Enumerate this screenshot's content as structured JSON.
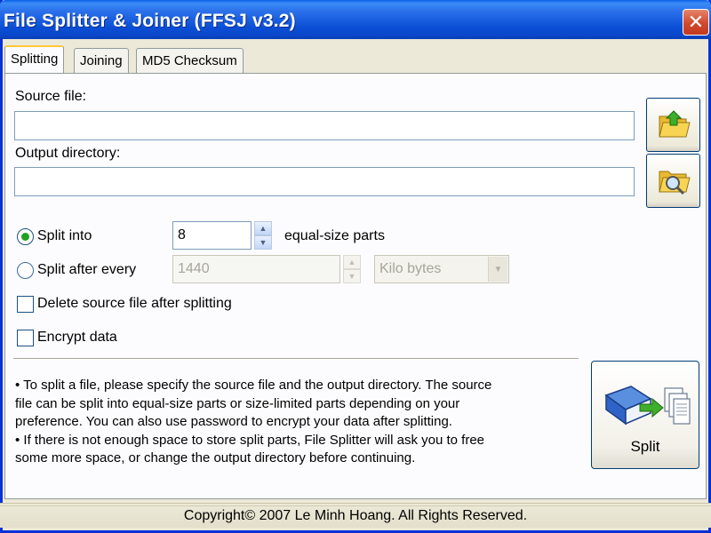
{
  "window": {
    "title": "File Splitter & Joiner (FFSJ v3.2)",
    "close_glyph": "✕"
  },
  "tabs": [
    {
      "label": "Splitting",
      "active": true
    },
    {
      "label": "Joining",
      "active": false
    },
    {
      "label": "MD5 Checksum",
      "active": false
    }
  ],
  "splitting": {
    "source_label": "Source file:",
    "source_value": "",
    "output_label": "Output directory:",
    "output_value": "",
    "browse_source_icon": "folder-open-icon",
    "browse_output_icon": "folder-search-icon",
    "split_into": {
      "label": "Split into",
      "value": "8",
      "suffix": "equal-size parts",
      "selected": true
    },
    "split_after": {
      "label": "Split after every",
      "value": "1440",
      "unit": "Kilo bytes",
      "selected": false
    },
    "delete_source": {
      "label": "Delete source file after splitting",
      "checked": false
    },
    "encrypt": {
      "label": "Encrypt data",
      "checked": false
    },
    "info_lines": [
      "• To split a file, please specify the source file and the output directory. The source",
      "file can be split into equal-size parts or size-limited parts depending on your",
      "preference. You can also use password to encrypt your data after splitting.",
      "• If there is not enough space to store split parts, File Splitter will ask you to free",
      "some more space, or change the output directory before continuing."
    ],
    "split_button": {
      "label": "Split",
      "icon": "book-split-icon"
    }
  },
  "status": {
    "text": "Copyright© 2007 Le Minh Hoang. All Rights Reserved."
  },
  "colors": {
    "title_blue": "#0a4fd6",
    "accent_green": "#21a121",
    "tab_highlight": "#ffc83c"
  }
}
